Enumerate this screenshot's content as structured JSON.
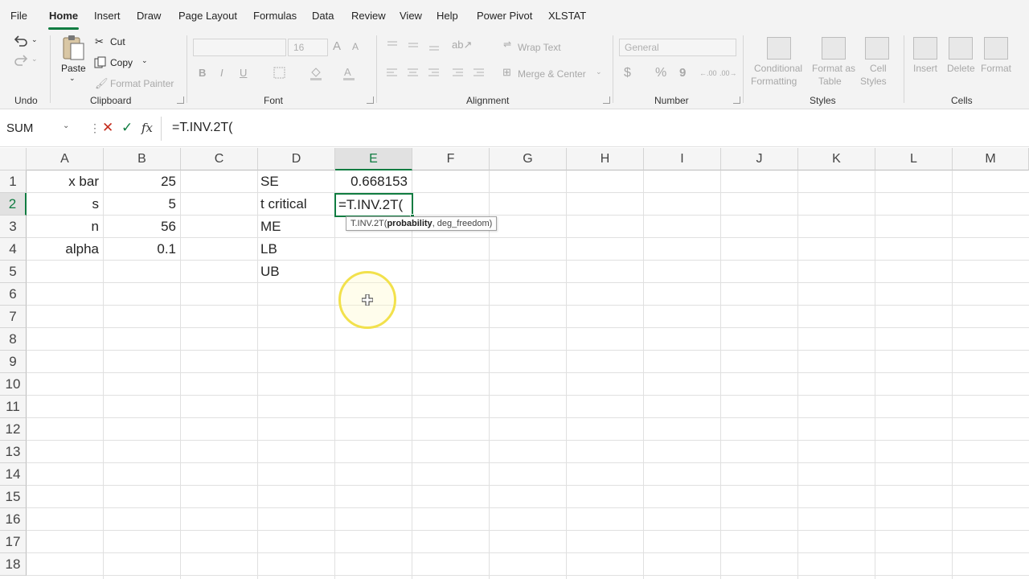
{
  "menu": {
    "tabs": [
      "File",
      "Home",
      "Insert",
      "Draw",
      "Page Layout",
      "Formulas",
      "Data",
      "Review",
      "View",
      "Help",
      "Power Pivot",
      "XLSTAT"
    ],
    "active": "Home"
  },
  "ribbon": {
    "groups": {
      "undo": "Undo",
      "clipboard": "Clipboard",
      "font": "Font",
      "alignment": "Alignment",
      "number": "Number",
      "styles": "Styles",
      "cells": "Cells"
    },
    "clipboard": {
      "paste": "Paste",
      "cut": "Cut",
      "copy": "Copy",
      "format_painter": "Format Painter"
    },
    "font": {
      "family": "",
      "size": "16",
      "bold": "B",
      "italic": "I",
      "underline": "U"
    },
    "alignment": {
      "wrap_text": "Wrap Text",
      "merge_center": "Merge & Center"
    },
    "number": {
      "format": "General",
      "currency": "$",
      "percent": "%",
      "comma": "9"
    },
    "styles": {
      "conditional_1": "Conditional",
      "conditional_2": "Formatting",
      "format_table_1": "Format as",
      "format_table_2": "Table",
      "cell_styles_1": "Cell",
      "cell_styles_2": "Styles"
    },
    "cells": {
      "insert": "Insert",
      "delete": "Delete",
      "format": "Format"
    }
  },
  "formula_bar": {
    "name_box": "SUM",
    "fx": "fx",
    "content": "=T.INV.2T("
  },
  "columns": [
    "A",
    "B",
    "C",
    "D",
    "E",
    "F",
    "G",
    "H",
    "I",
    "J",
    "K",
    "L",
    "M"
  ],
  "rows": [
    "1",
    "2",
    "3",
    "4",
    "5",
    "6",
    "7",
    "8",
    "9",
    "10",
    "11",
    "12",
    "13",
    "14",
    "15",
    "16",
    "17",
    "18"
  ],
  "cells": {
    "A1": "x bar",
    "B1": "25",
    "A2": "s",
    "B2": "5",
    "A3": "n",
    "B3": "56",
    "A4": "alpha",
    "B4": "0.1",
    "D1": "SE",
    "E1": "0.668153",
    "D2": "t critical",
    "E2": "=T.INV.2T(",
    "D3": "ME",
    "D4": "LB",
    "D5": "UB"
  },
  "tooltip": {
    "func": "T.INV.2T(",
    "arg1": "probability",
    "rest": ", deg_freedom)"
  },
  "colors": {
    "accent": "#107c41",
    "cursor_ring": "#f2e14c"
  }
}
